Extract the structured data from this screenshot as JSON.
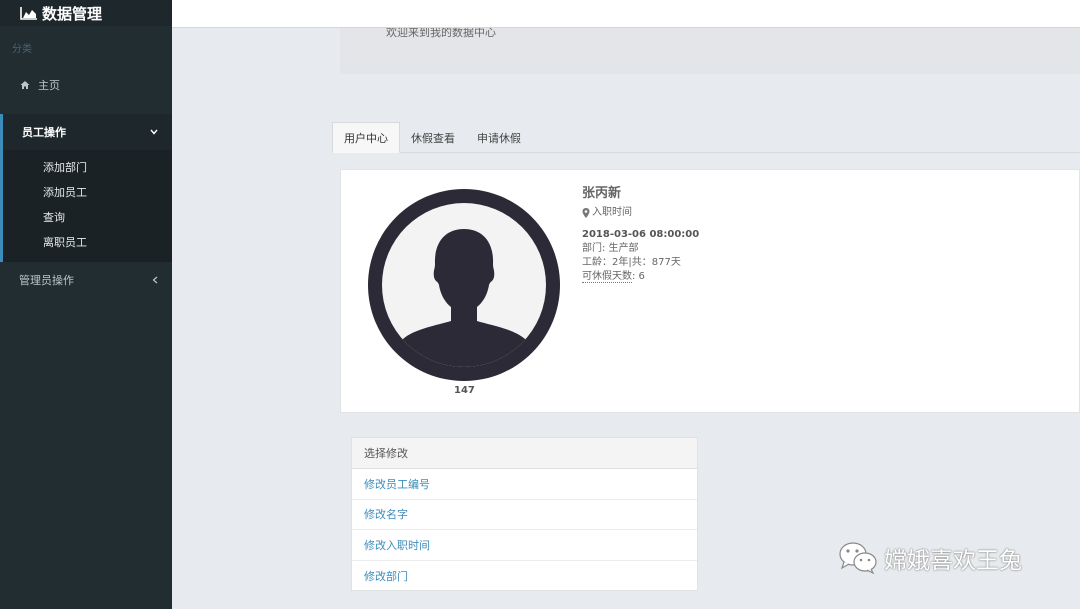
{
  "sidebar": {
    "brand": "数据管理",
    "section_header": "分类",
    "home_label": "主页",
    "group_label": "员工操作",
    "group_items": [
      "添加部门",
      "添加员工",
      "查询",
      "离职员工"
    ],
    "admin_label": "管理员操作"
  },
  "welcome": {
    "text": "欢迎来到我的数据中心"
  },
  "tabs": [
    "用户中心",
    "休假查看",
    "申请休假"
  ],
  "profile": {
    "name": "张丙新",
    "hire_label": "入职时间",
    "hire_date": "2018-03-06 08:00:00",
    "department": "部门: 生产部",
    "seniority": "工龄：2年|共：877天",
    "leave_label": "可休假天数",
    "leave_value": ": 6",
    "employee_number": "147"
  },
  "edit_panel": {
    "header": "选择修改",
    "items": [
      "修改员工编号",
      "修改名字",
      "修改入职时间",
      "修改部门"
    ]
  },
  "watermark": {
    "text": "嫦娥喜欢王兔"
  },
  "colors": {
    "sidebar_bg": "#222d32",
    "accent": "#3c8dbc",
    "link": "#3c8dbc"
  }
}
